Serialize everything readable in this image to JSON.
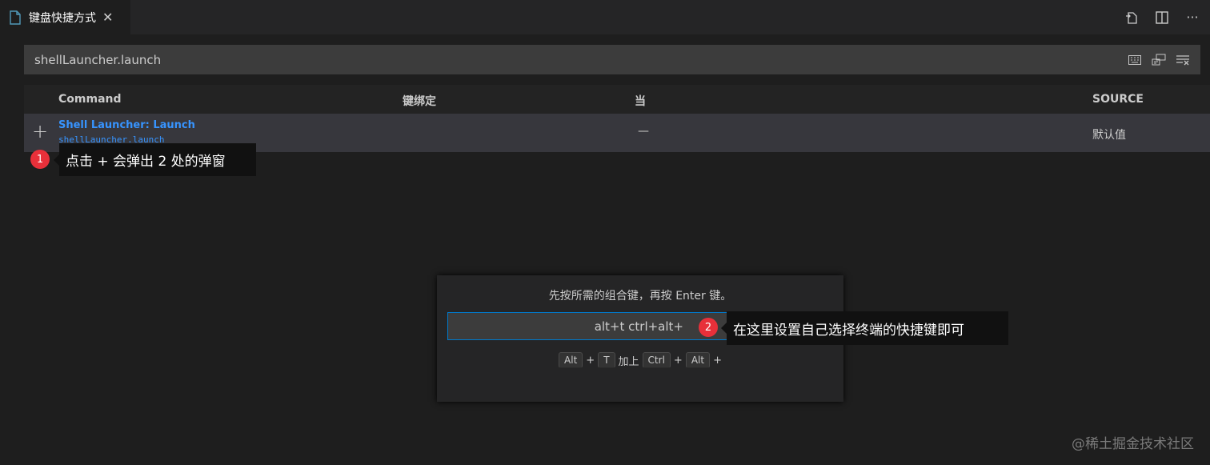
{
  "tab": {
    "icon": "file-icon",
    "label": "键盘快捷方式",
    "close": "✕"
  },
  "actions": [
    {
      "icon": "open-keybindings-json-icon"
    },
    {
      "icon": "split-editor-icon"
    },
    {
      "icon": "more-actions-icon",
      "label": "···"
    }
  ],
  "search": {
    "value": "shellLauncher.launch",
    "tools": [
      "record-keys-icon",
      "sort-by-precedence-icon",
      "clear-input-icon"
    ]
  },
  "table": {
    "headers": {
      "command": "Command",
      "keybinding": "键绑定",
      "when": "当",
      "source": "SOURCE"
    },
    "row": {
      "add": "+",
      "command_title": "Shell Launcher: Launch",
      "command_id": "shellLauncher.launch",
      "when": "—",
      "source": "默认值"
    }
  },
  "annotations": {
    "one": {
      "number": "1",
      "text": "点击 + 会弹出 2 处的弹窗"
    },
    "two": {
      "number": "2",
      "text": "在这里设置自己选择终端的快捷键即可"
    }
  },
  "dialog": {
    "message": "先按所需的组合键，再按 Enter 键。",
    "input_value": "alt+t ctrl+alt+",
    "keys": {
      "k1": "Alt",
      "p1": "+",
      "k2": "T",
      "then": "加上",
      "k3": "Ctrl",
      "p2": "+",
      "k4": "Alt",
      "p3": "+"
    }
  },
  "watermark": "@稀土掘金技术社区",
  "colors": {
    "accent_link": "#3794ff",
    "focus_border": "#007acc",
    "badge": "#e8303a"
  }
}
